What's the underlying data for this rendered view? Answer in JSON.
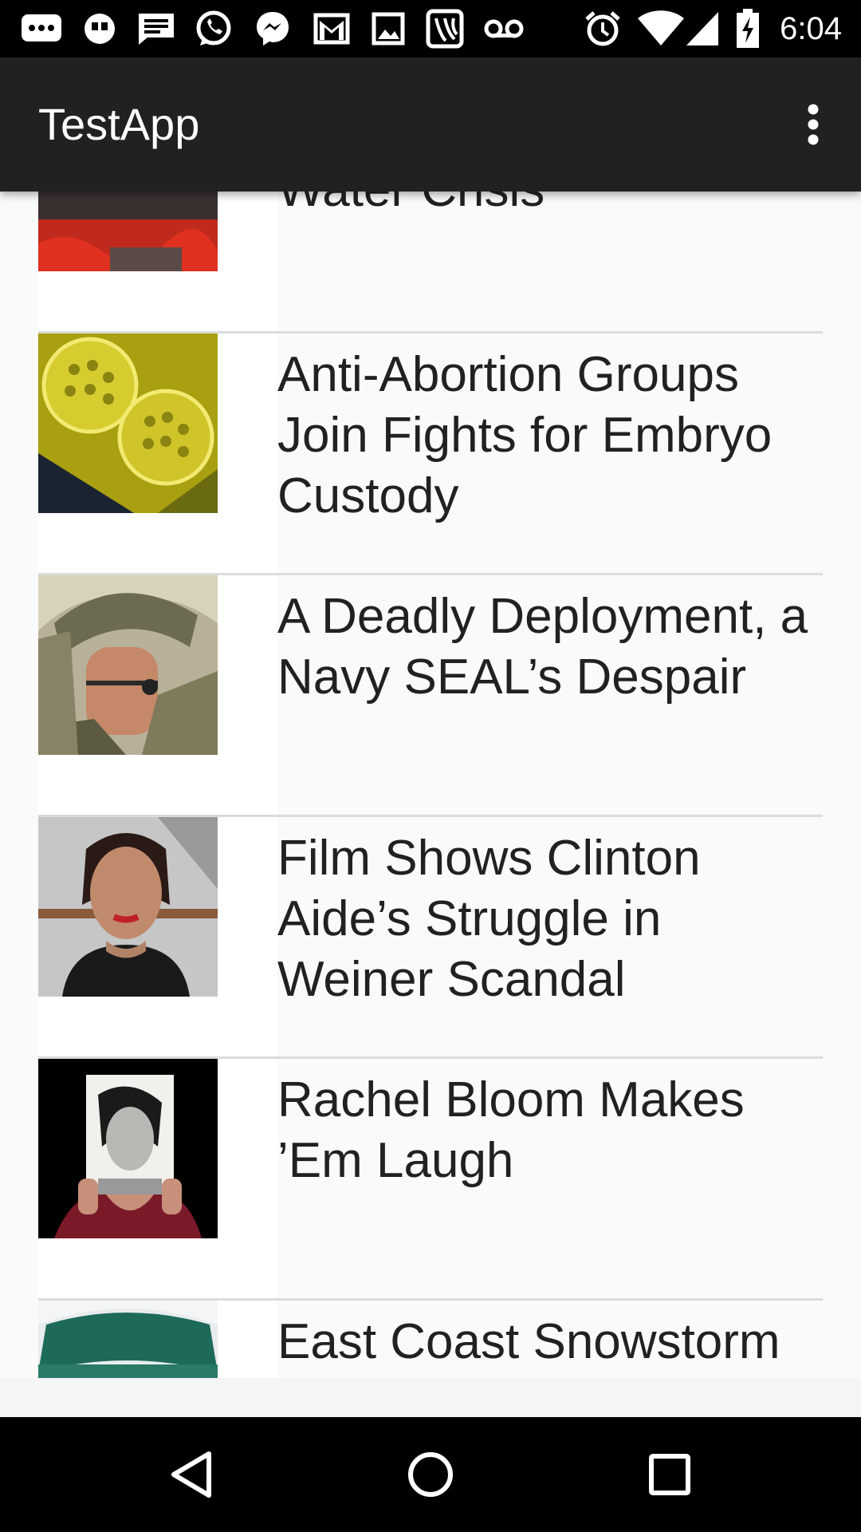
{
  "status_bar": {
    "time": "6:04",
    "icons": [
      "chat-bubble-icon",
      "quote-bubble-icon",
      "message-icon",
      "whatsapp-icon",
      "messenger-icon",
      "gmail-icon",
      "image-icon",
      "saavn-icon",
      "voicemail-icon",
      "alarm-icon",
      "wifi-icon",
      "signal-icon",
      "battery-charging-icon"
    ]
  },
  "app_bar": {
    "title": "TestApp",
    "menu_icon": "more-vert-icon"
  },
  "articles": [
    {
      "headline": "Water Crisis",
      "thumb": "protest-photo"
    },
    {
      "headline": "Anti-Abortion Groups Join Fights for Embryo Custody",
      "thumb": "embryo-dish-photo"
    },
    {
      "headline": "A Deadly Deployment, a Navy SEAL’s Despair",
      "thumb": "soldier-photo"
    },
    {
      "headline": "Film Shows Clinton Aide’s Struggle in Weiner Scandal",
      "thumb": "woman-portrait-photo"
    },
    {
      "headline": "Rachel Bloom Makes ’Em Laugh",
      "thumb": "photo-holding-portrait"
    },
    {
      "headline": "East Coast Snowstorm Is Expected to Hit",
      "thumb": "snow-hat-photo"
    }
  ],
  "nav_bar": {
    "back": "back-icon",
    "home": "home-icon",
    "recents": "recents-icon"
  }
}
